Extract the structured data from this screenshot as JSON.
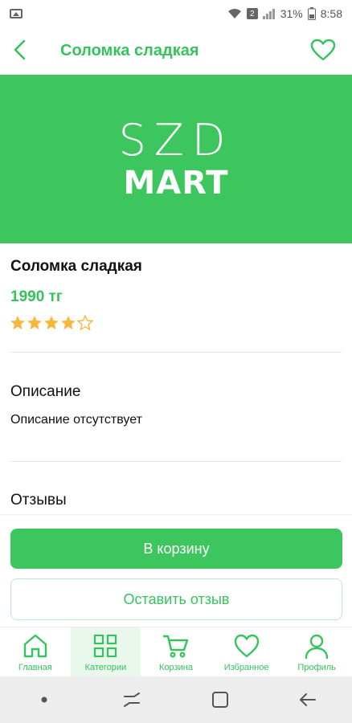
{
  "status_bar": {
    "battery_percent": "31%",
    "time": "8:58",
    "sim_badge": "2"
  },
  "header": {
    "title": "Соломка сладкая"
  },
  "banner": {
    "logo_line1": "SZD",
    "logo_line2": "MART"
  },
  "product": {
    "name": "Соломка сладкая",
    "price": "1990 тг",
    "rating": 4,
    "rating_max": 5
  },
  "description": {
    "label": "Описание",
    "text": "Описание отсутствует"
  },
  "reviews": {
    "label": "Отзывы"
  },
  "actions": {
    "add_to_cart": "В корзину",
    "leave_review": "Оставить отзыв"
  },
  "bottom_nav": {
    "items": [
      {
        "label": "Главная",
        "icon": "home-icon"
      },
      {
        "label": "Категории",
        "icon": "grid-icon",
        "active": true
      },
      {
        "label": "Корзина",
        "icon": "cart-icon"
      },
      {
        "label": "Избранное",
        "icon": "heart-icon"
      },
      {
        "label": "Профиль",
        "icon": "user-icon"
      }
    ]
  },
  "colors": {
    "accent": "#3dc65d",
    "star": "#f5b83d"
  }
}
